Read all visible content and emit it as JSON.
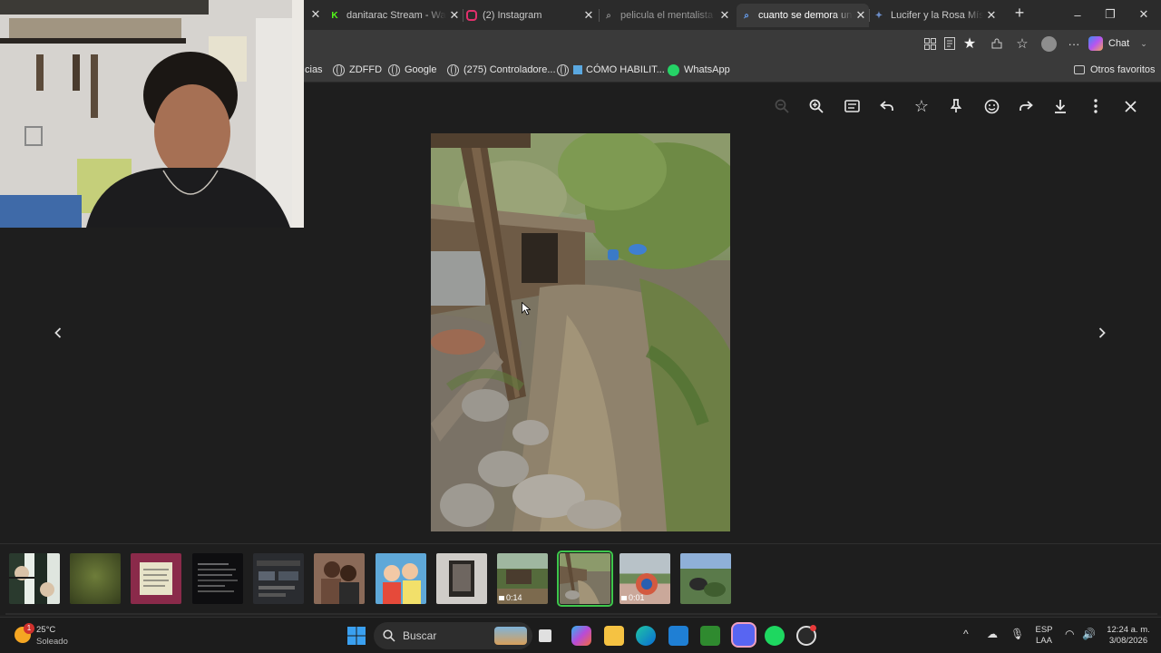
{
  "tabs": [
    {
      "title": "danitarac Stream - Watc",
      "favicon": "kick-icon",
      "favicon_color": "#53fc18"
    },
    {
      "title": "(2) Instagram",
      "favicon": "instagram-icon",
      "favicon_color": "#e1306c"
    },
    {
      "title": "pelicula el mentalista - B",
      "favicon": "search-icon",
      "favicon_color": "#8a8a8a"
    },
    {
      "title": "cuanto se demora una p",
      "favicon": "search-icon",
      "favicon_color": "#6aa7ff"
    },
    {
      "title": "Lucifer y la Rosa Mística",
      "favicon": "star-icon",
      "favicon_color": "#6b8cc7"
    }
  ],
  "active_tab_index": 3,
  "new_tab_symbol": "+",
  "window_controls": {
    "minimize": "–",
    "restore": "❐",
    "close": "✕"
  },
  "toolbar": {
    "chat_label": "Chat",
    "icons": [
      "apps-icon",
      "reader-icon",
      "favorite-star-icon",
      "extensions-icon",
      "favorites-icon",
      "profile-icon",
      "more-icon"
    ]
  },
  "bookmarks": [
    {
      "label": "cias",
      "icon": "none"
    },
    {
      "label": "ZDFFD",
      "icon": "globe-icon"
    },
    {
      "label": "Google",
      "icon": "globe-icon"
    },
    {
      "label": "(275) Controladore...",
      "icon": "globe-icon"
    },
    {
      "label": "CÓMO HABILIT...",
      "icon": "globe-icon"
    },
    {
      "label": "WhatsApp",
      "icon": "whatsapp-icon"
    }
  ],
  "other_favorites": "Otros favoritos",
  "viewer": {
    "toolbar_icons": [
      "zoom-out-icon",
      "zoom-in-icon",
      "caption-icon",
      "reply-icon",
      "star-icon",
      "pin-icon",
      "emoji-icon",
      "forward-icon",
      "download-icon",
      "more-vertical-icon",
      "close-icon"
    ],
    "thumbnails": [
      {
        "label": "",
        "video": false,
        "selected": false
      },
      {
        "label": "",
        "video": false,
        "selected": false
      },
      {
        "label": "",
        "video": false,
        "selected": false
      },
      {
        "label": "",
        "video": false,
        "selected": false
      },
      {
        "label": "",
        "video": false,
        "selected": false
      },
      {
        "label": "",
        "video": false,
        "selected": false
      },
      {
        "label": "",
        "video": false,
        "selected": false
      },
      {
        "label": "",
        "video": false,
        "selected": false
      },
      {
        "label": "0:14",
        "video": true,
        "selected": false
      },
      {
        "label": "",
        "video": false,
        "selected": true
      },
      {
        "label": "0:01",
        "video": true,
        "selected": false
      },
      {
        "label": "",
        "video": false,
        "selected": false
      }
    ]
  },
  "taskbar": {
    "weather_temp": "25°C",
    "weather_desc": "Soleado",
    "weather_badge": "1",
    "search_placeholder": "Buscar",
    "language_line1": "ESP",
    "language_line2": "LAA",
    "time": "12:24 a. m.",
    "date": "3/08/2026"
  },
  "colors": {
    "selected_thumb_outline": "#3ec74c",
    "titlebar": "#2b2b2b",
    "toolbar": "#3a3a3a",
    "viewer_bg": "#1e1e1e"
  }
}
